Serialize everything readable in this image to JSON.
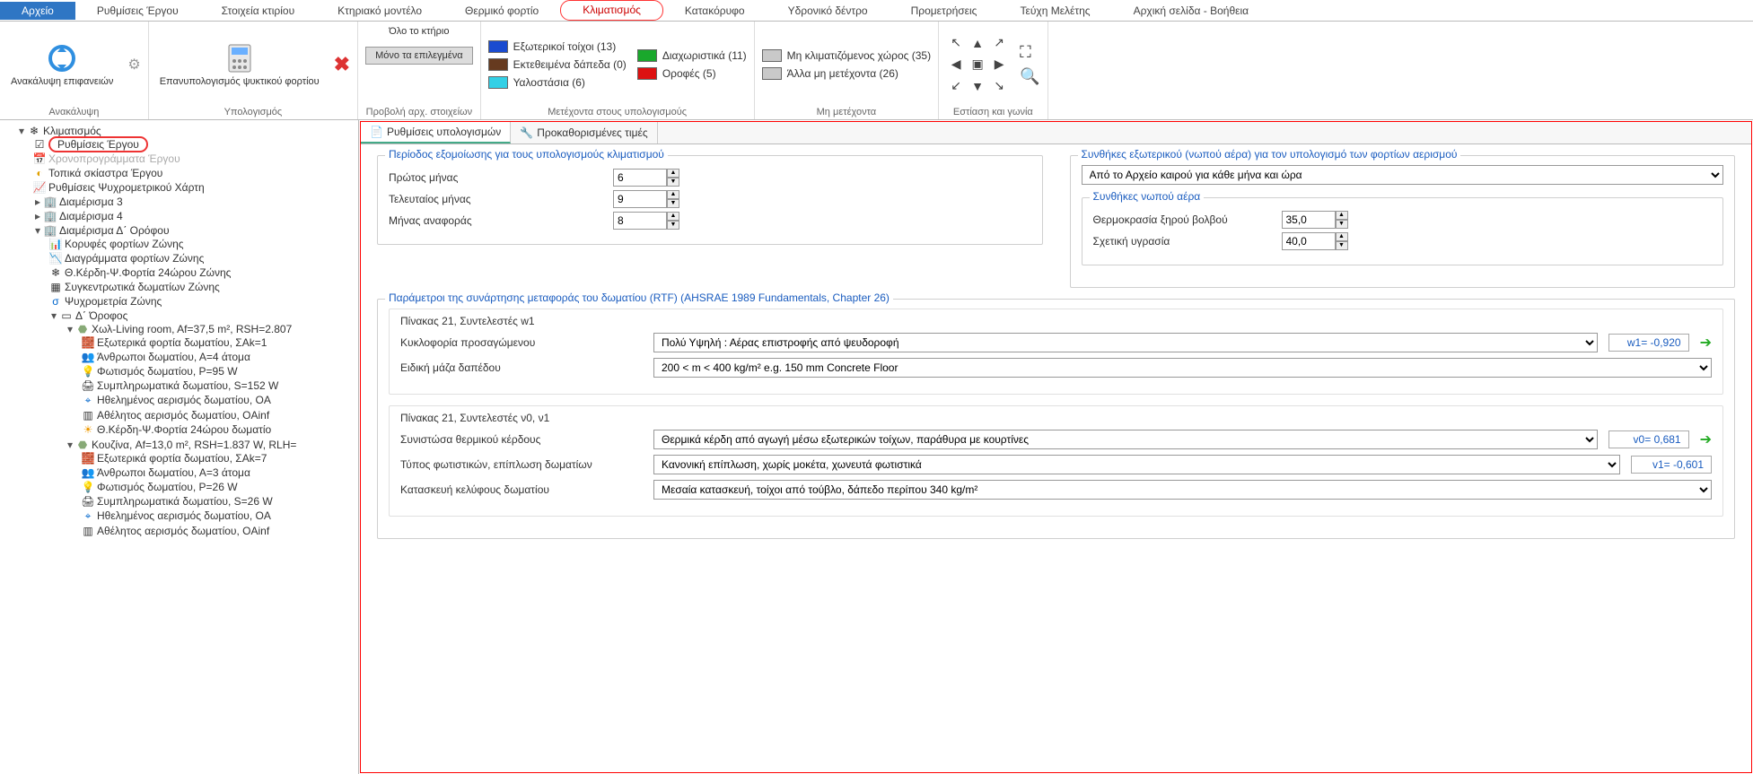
{
  "menu": {
    "file": "Αρχείο",
    "items": [
      "Ρυθμίσεις Έργου",
      "Στοιχεία κτιρίου",
      "Κτηριακό μοντέλο",
      "Θερμικό φορτίο",
      "Κλιματισμός",
      "Κατακόρυφο",
      "Υδρονικό δέντρο",
      "Προμετρήσεις",
      "Τεύχη Μελέτης",
      "Αρχική σελίδα - Βοήθεια"
    ],
    "active": "Κλιματισμός"
  },
  "ribbon": {
    "g1": {
      "label": "Ανακάλυψη",
      "btn": "Ανακάλυψη\nεπιφανειών"
    },
    "g2": {
      "label": "Υπολογισμός",
      "btn": "Επανυπολογισμός\nψυκτικού φορτίου"
    },
    "g3": {
      "label": "Προβολή αρχ. στοιχείων",
      "opt1": "Όλο το κτήριο",
      "opt2": "Μόνο τα επιλεγμένα"
    },
    "g4": {
      "label": "Μετέχοντα στους υπολογισμούς",
      "items": [
        {
          "c": "#1a4bd0",
          "t": "Εξωτερικοί τοίχοι (13)"
        },
        {
          "c": "#663a1f",
          "t": "Εκτεθειμένα δάπεδα (0)"
        },
        {
          "c": "#33d0e6",
          "t": "Υαλοστάσια (6)"
        },
        {
          "c": "#1aa82c",
          "t": "Διαχωριστικά (11)"
        },
        {
          "c": "#d11",
          "t": "Οροφές (5)"
        }
      ]
    },
    "g5": {
      "label": "Μη μετέχοντα",
      "items": [
        {
          "c": "#c9c9c9",
          "t": "Μη κλιματιζόμενος χώρος (35)"
        },
        {
          "c": "#c9c9c9",
          "t": "Άλλα μη μετέχοντα (26)"
        }
      ]
    },
    "g6": {
      "label": "Εστίαση και γωνία"
    }
  },
  "tree": {
    "root": "Κλιματισμός",
    "n1": "Ρυθμίσεις Έργου",
    "n2": "Χρονοπρογράμματα Έργου",
    "n3": "Τοπικά σκίαστρα Έργου",
    "n4": "Ρυθμίσεις Ψυχρομετρικού Χάρτη",
    "n5": "Διαμέρισμα 3",
    "n6": "Διαμέρισμα 4",
    "n7": "Διαμέρισμα Δ΄ Ορόφου",
    "n7c": [
      "Κορυφές φορτίων Ζώνης",
      "Διαγράμματα φορτίων Ζώνης",
      "Θ.Κέρδη-Ψ.Φορτία 24ώρου Ζώνης",
      "Συγκεντρωτικά δωματίων Ζώνης",
      "Ψυχρομετρία Ζώνης"
    ],
    "n8": "Δ΄ Όροφος",
    "r1": "Χωλ-Living room, Af=37,5 m², RSH=2.807",
    "r1c": [
      "Εξωτερικά φορτία δωματίου, ΣAk=1",
      "Άνθρωποι δωματίου, Α=4 άτομα",
      "Φωτισμός δωματίου, P=95 W",
      "Συμπληρωματικά δωματίου, S=152 W",
      "Ηθελημένος αερισμός δωματίου, OA",
      "Αθέλητος αερισμός δωματίου, OAinf",
      "Θ.Κέρδη-Ψ.Φορτία 24ώρου δωματίο"
    ],
    "r2": "Κουζίνα, Af=13,0 m², RSH=1.837 W, RLH=",
    "r2c": [
      "Εξωτερικά φορτία δωματίου, ΣAk=7",
      "Άνθρωποι δωματίου, Α=3 άτομα",
      "Φωτισμός δωματίου, P=26 W",
      "Συμπληρωματικά δωματίου, S=26 W",
      "Ηθελημένος αερισμός δωματίου, OA",
      "Αθέλητος αερισμός δωματίου, OAinf"
    ]
  },
  "tabs": {
    "t1": "Ρυθμίσεις υπολογισμών",
    "t2": "Προκαθορισμένες τιμές"
  },
  "form": {
    "period": {
      "title": "Περίοδος εξομοίωσης για τους υπολογισμούς κλιματισμού",
      "l1": "Πρώτος μήνας",
      "v1": "6",
      "l2": "Τελευταίος μήνας",
      "v2": "9",
      "l3": "Μήνας αναφοράς",
      "v3": "8"
    },
    "ext": {
      "title": "Συνθήκες εξωτερικού (νωπού αέρα) για τον υπολογισμό των φορτίων αερισμού",
      "combo": "Από το Αρχείο καιρού για κάθε μήνα και ώρα",
      "inner": "Συνθήκες νωπού αέρα",
      "l1": "Θερμοκρασία ξηρού βολβού",
      "v1": "35,0",
      "l2": "Σχετική υγρασία",
      "v2": "40,0"
    },
    "rtf": {
      "title": "Παράμετροι της συνάρτησης μεταφοράς του δωματίου (RTF) (AHSRAE 1989 Fundamentals, Chapter 26)",
      "s1": "Πίνακας 21, Συντελεστές w1",
      "l1": "Κυκλοφορία προσαγώμενου",
      "c1": "Πολύ Υψηλή : Αέρας επιστροφής από ψευδοροφή",
      "w1": "w1= -0,920",
      "l2": "Ειδική μάζα δαπέδου",
      "c2": "200 < m < 400 kg/m²  e.g. 150 mm Concrete Floor",
      "s2": "Πίνακας 21, Συντελεστές ν0, ν1",
      "l3": "Συνιστώσα θερμικού κέρδους",
      "c3": "Θερμικά κέρδη από αγωγή μέσω εξωτερικών τοίχων, παράθυρα με κουρτίνες",
      "v0": "v0= 0,681",
      "l4": "Τύπος φωτιστικών, επίπλωση δωματίων",
      "c4": "Κανονική επίπλωση, χωρίς μοκέτα, χωνευτά φωτιστικά",
      "v1": "v1= -0,601",
      "l5": "Κατασκευή κελύφους δωματίου",
      "c5": "Μεσαία κατασκευή, τοίχοι από τούβλο, δάπεδο περίπου 340 kg/m²"
    }
  }
}
